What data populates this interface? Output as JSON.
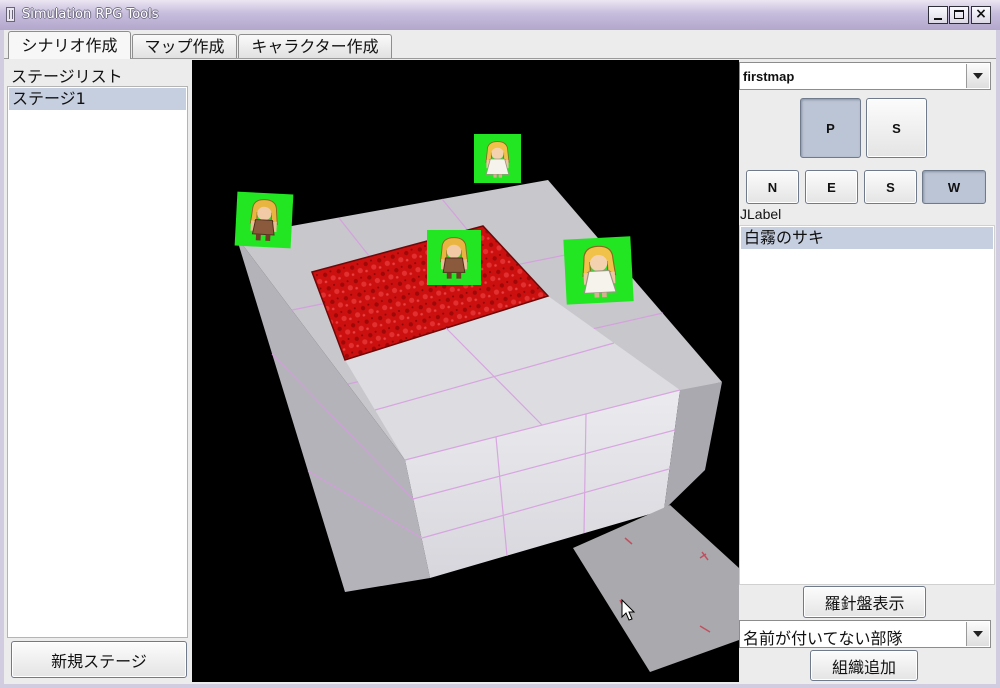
{
  "window": {
    "title": "Simulation RPG Tools",
    "app_icon": "java-app-icon",
    "minimize_icon": "minimize-icon",
    "maximize_icon": "maximize-icon",
    "close_icon": "close-icon"
  },
  "tabs": [
    {
      "label": "シナリオ作成",
      "selected": true
    },
    {
      "label": "マップ作成",
      "selected": false
    },
    {
      "label": "キャラクター作成",
      "selected": false
    }
  ],
  "stage_panel": {
    "header": "ステージリスト",
    "stages": [
      {
        "label": "ステージ1",
        "selected": true
      }
    ],
    "new_stage_button": "新規ステージ"
  },
  "map_view": {
    "cursor_icon": "mouse-pointer-icon",
    "unit_icon": "character-sprite-icon"
  },
  "side_panel": {
    "map_select": {
      "value": "firstmap",
      "arrow_icon": "chevron-down-icon"
    },
    "view_mode_buttons": [
      {
        "label": "P",
        "pressed": true
      },
      {
        "label": "S",
        "pressed": false
      }
    ],
    "direction_buttons": [
      {
        "label": "N",
        "pressed": false
      },
      {
        "label": "E",
        "pressed": false
      },
      {
        "label": "S",
        "pressed": false
      },
      {
        "label": "W",
        "pressed": true
      }
    ],
    "label": "JLabel",
    "characters": [
      {
        "label": "白霧のサキ",
        "selected": true
      }
    ],
    "compass_button": "羅針盤表示",
    "unit_select": {
      "value": "名前が付いてない部隊",
      "arrow_icon": "chevron-down-icon"
    },
    "add_group_button": "組織追加"
  },
  "colors": {
    "selection": "#c6cfe0",
    "pressed_button": "#bcc5d5",
    "viewport_background": "#000000",
    "lava_tile": "#cc1010",
    "unit_marker": "#22e622"
  }
}
